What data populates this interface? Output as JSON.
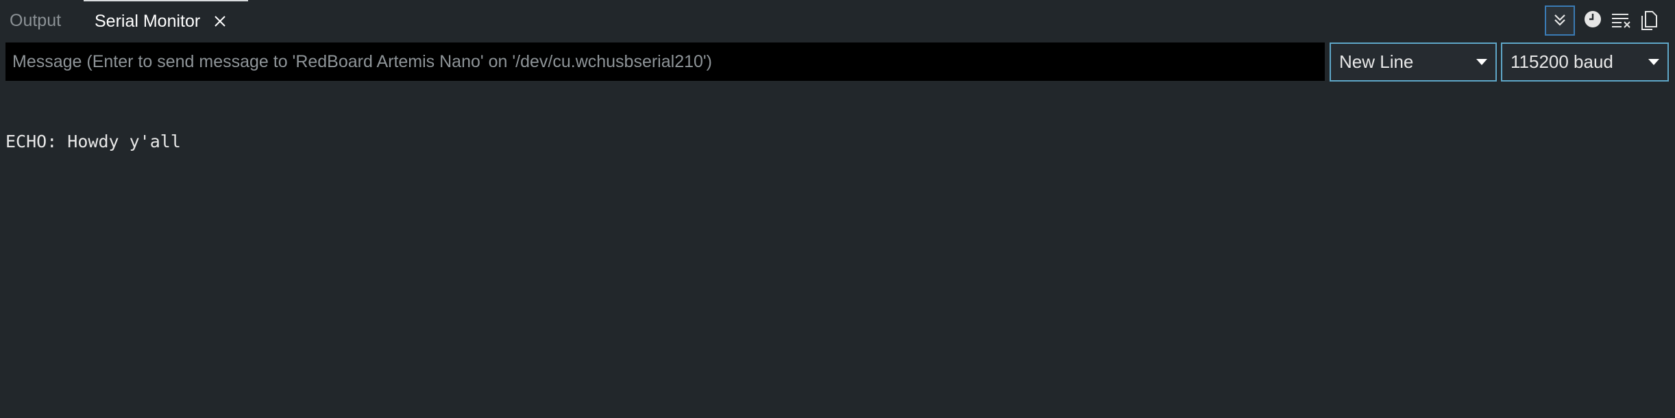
{
  "tabs": {
    "output_label": "Output",
    "serial_label": "Serial Monitor"
  },
  "toolbar": {
    "autoscroll_icon": "double-chevron-down-icon",
    "timestamp_icon": "clock-icon",
    "clear_icon": "clear-output-icon",
    "copy_icon": "copy-icon",
    "accent": "#3a7bb5"
  },
  "message": {
    "placeholder": "Message (Enter to send message to 'RedBoard Artemis Nano' on '/dev/cu.wchusbserial210')",
    "value": ""
  },
  "line_ending": {
    "selected": "New Line"
  },
  "baud": {
    "selected": "115200 baud"
  },
  "output": {
    "lines": [
      "ECHO: Howdy y'all"
    ]
  },
  "colors": {
    "background": "#22272b",
    "select_border": "#5fa7c8"
  }
}
